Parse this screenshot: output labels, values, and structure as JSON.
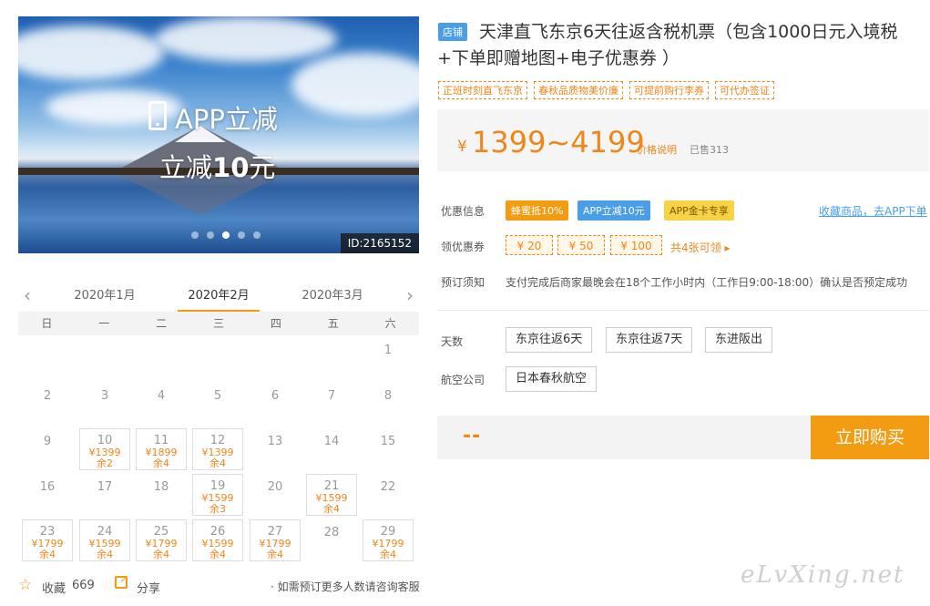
{
  "hero": {
    "line1": "APP立减",
    "line2_prefix": "立减",
    "line2_amount": "10",
    "line2_suffix": "元",
    "id_label": "ID:2165152",
    "slides": [
      false,
      false,
      true,
      false,
      false
    ]
  },
  "calendar": {
    "prev_month": "2020年1月",
    "current_month": "2020年2月",
    "next_month": "2020年3月",
    "weekdays": [
      "日",
      "一",
      "二",
      "三",
      "四",
      "五",
      "六"
    ],
    "days": [
      {
        "day": "1",
        "col": 6,
        "row": 0
      },
      {
        "day": "2",
        "col": 0,
        "row": 1
      },
      {
        "day": "3",
        "col": 1,
        "row": 1
      },
      {
        "day": "4",
        "col": 2,
        "row": 1
      },
      {
        "day": "5",
        "col": 3,
        "row": 1
      },
      {
        "day": "6",
        "col": 4,
        "row": 1
      },
      {
        "day": "7",
        "col": 5,
        "row": 1
      },
      {
        "day": "8",
        "col": 6,
        "row": 1
      },
      {
        "day": "9",
        "col": 0,
        "row": 2
      },
      {
        "day": "10",
        "col": 1,
        "row": 2,
        "price": "¥1399",
        "remain": "余2"
      },
      {
        "day": "11",
        "col": 2,
        "row": 2,
        "price": "¥1899",
        "remain": "余4"
      },
      {
        "day": "12",
        "col": 3,
        "row": 2,
        "price": "¥1399",
        "remain": "余4"
      },
      {
        "day": "13",
        "col": 4,
        "row": 2
      },
      {
        "day": "14",
        "col": 5,
        "row": 2
      },
      {
        "day": "15",
        "col": 6,
        "row": 2
      },
      {
        "day": "16",
        "col": 0,
        "row": 3
      },
      {
        "day": "17",
        "col": 1,
        "row": 3
      },
      {
        "day": "18",
        "col": 2,
        "row": 3
      },
      {
        "day": "19",
        "col": 3,
        "row": 3,
        "price": "¥1599",
        "remain": "余3"
      },
      {
        "day": "20",
        "col": 4,
        "row": 3
      },
      {
        "day": "21",
        "col": 5,
        "row": 3,
        "price": "¥1599",
        "remain": "余4"
      },
      {
        "day": "22",
        "col": 6,
        "row": 3
      },
      {
        "day": "23",
        "col": 0,
        "row": 4,
        "price": "¥1799",
        "remain": "余4"
      },
      {
        "day": "24",
        "col": 1,
        "row": 4,
        "price": "¥1599",
        "remain": "余4"
      },
      {
        "day": "25",
        "col": 2,
        "row": 4,
        "price": "¥1799",
        "remain": "余4"
      },
      {
        "day": "26",
        "col": 3,
        "row": 4,
        "price": "¥1599",
        "remain": "余4"
      },
      {
        "day": "27",
        "col": 4,
        "row": 4,
        "price": "¥1799",
        "remain": "余4"
      },
      {
        "day": "28",
        "col": 5,
        "row": 4
      },
      {
        "day": "29",
        "col": 6,
        "row": 4,
        "price": "¥1799",
        "remain": "余4"
      }
    ]
  },
  "footer": {
    "fav_label": "收藏",
    "fav_count": "669",
    "share_label": "分享",
    "consult": "· 如需预订更多人数请咨询客服"
  },
  "product": {
    "store_badge": "店铺",
    "title": "天津直飞东京6天往返含税机票（包含1000日元入境税+下单即赠地图+电子优惠券 ）",
    "tags": [
      "正班时刻直飞东京",
      "春秋品质物美价廉",
      "可提前购行李券",
      "可代办签证"
    ],
    "price_symbol": "¥",
    "price_range": "1399~4199",
    "price_note": "价格说明",
    "sold": "已售313"
  },
  "promo": {
    "label": "优惠信息",
    "items": [
      "蜂蜜抵10%",
      "APP立减10元",
      "APP金卡专享"
    ],
    "fav_app": "收藏商品，去APP下单"
  },
  "coupons": {
    "label": "领优惠券",
    "items": [
      "¥ 20",
      "¥ 50",
      "¥ 100"
    ],
    "more": "共4张可领 ▸"
  },
  "booking": {
    "label": "预订须知",
    "notice": "支付完成后商家最晚会在18个工作小时内（工作日9:00-18:00）确认是否预定成功"
  },
  "options": {
    "days_label": "天数",
    "days": [
      "东京往返6天",
      "东京往返7天",
      "东进阪出"
    ],
    "airline_label": "航空公司",
    "airlines": [
      "日本春秋航空"
    ]
  },
  "buy": {
    "price_placeholder": "--",
    "button": "立即购买"
  },
  "watermark": "eLvXing.net",
  "colors": {
    "accent": "#f39c12",
    "price": "#f08519",
    "link": "#4a9ee8"
  }
}
